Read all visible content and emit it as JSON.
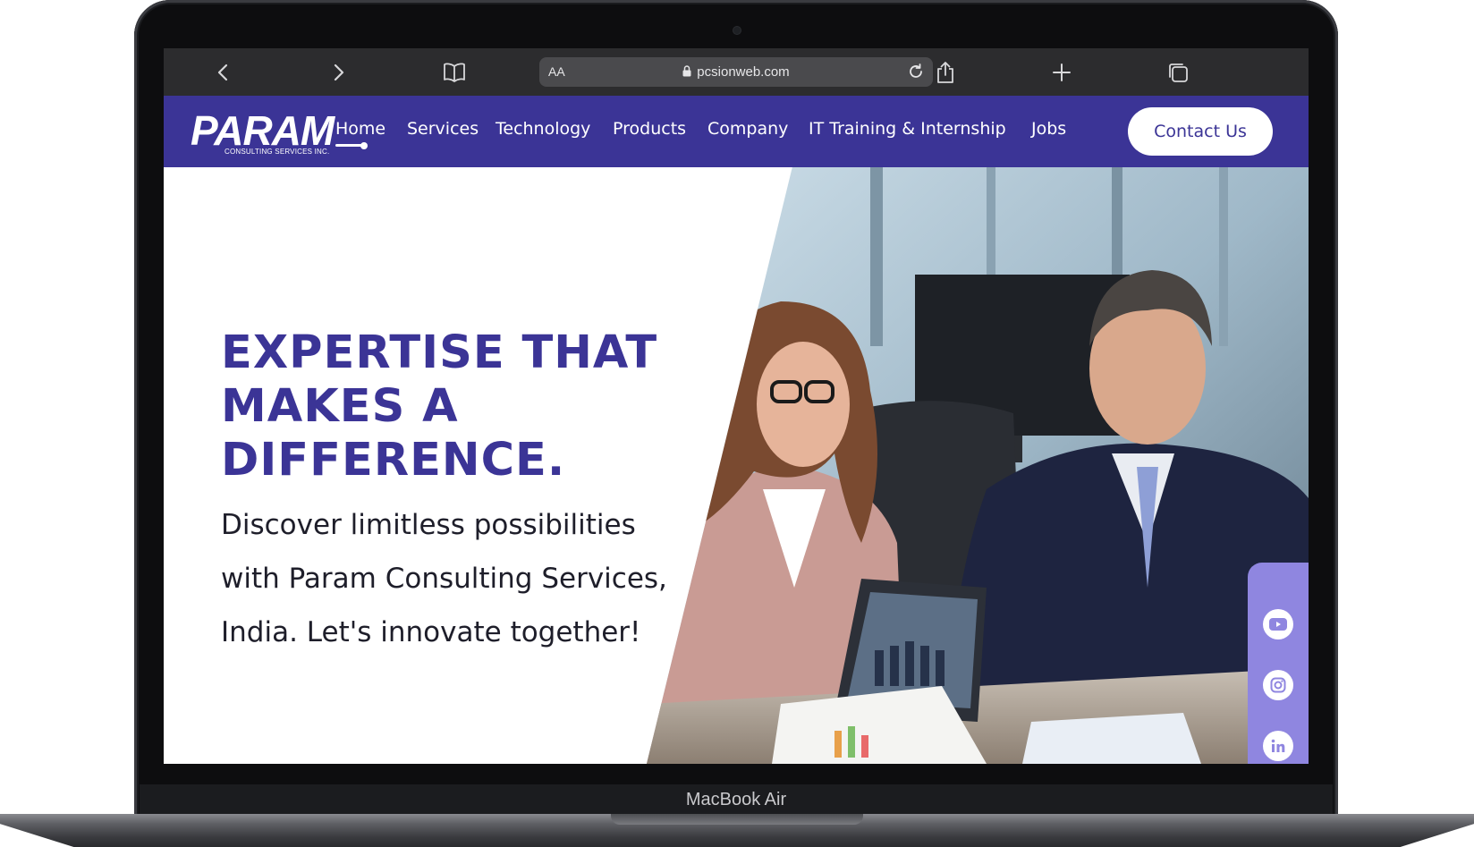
{
  "browser": {
    "url": "pcsionweb.com",
    "text_size_label": "AA",
    "icons": [
      "back-icon",
      "forward-icon",
      "bookmarks-icon",
      "lock-icon",
      "reload-icon",
      "share-icon",
      "new-tab-icon",
      "tabs-icon"
    ]
  },
  "site": {
    "logo": {
      "word": "PARAM",
      "subtitle": "CONSULTING SERVICES INC."
    },
    "nav": {
      "items": [
        "Home",
        "Services",
        "Technology",
        "Products",
        "Company",
        "IT Training & Internship",
        "Jobs"
      ],
      "active": "Home",
      "contact_label": "Contact Us"
    },
    "hero": {
      "headline": "EXPERTISE THAT MAKES A DIFFERENCE.",
      "subtext": "Discover limitless possibilities with Param Consulting Services, India. Let's innovate together!"
    },
    "social": [
      "youtube-icon",
      "instagram-icon",
      "linkedin-icon"
    ]
  },
  "device": {
    "label": "MacBook Air"
  },
  "colors": {
    "brand": "#3b3496",
    "social_panel": "#8f86e0",
    "toolbar": "#2c2c2e"
  }
}
